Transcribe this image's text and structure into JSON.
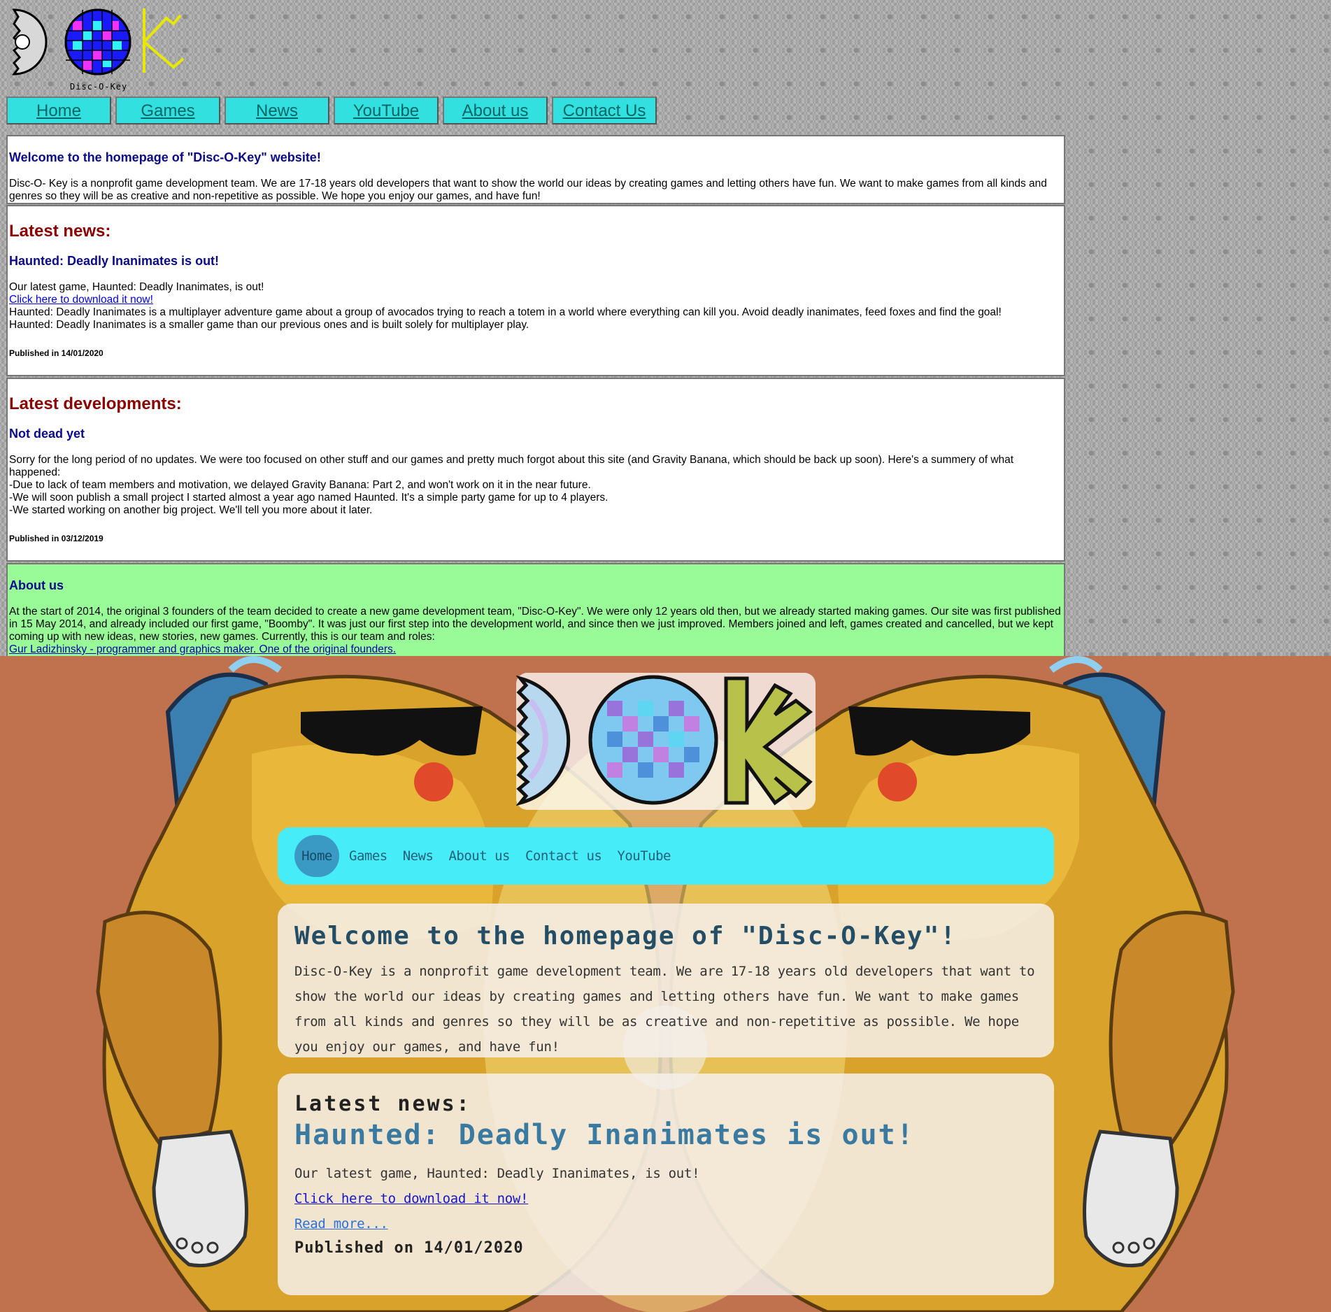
{
  "old_site": {
    "logo_caption": "Disc-O-Key",
    "nav": [
      "Home",
      "Games",
      "News",
      "YouTube",
      "About us",
      "Contact Us"
    ],
    "welcome": {
      "title": "Welcome to the homepage of \"Disc-O-Key\" website!",
      "text": "Disc-O- Key is a nonprofit game development team. We are 17-18 years old developers that want to show the world our ideas by creating games and letting others have fun. We want to make games from all kinds and genres so they will be as creative and non-repetitive as possible. We hope you enjoy our games, and have fun!"
    },
    "news": {
      "heading": "Latest news:",
      "title": "Haunted: Deadly Inanimates is out!",
      "line1": "Our latest game, Haunted: Deadly Inanimates, is out!",
      "link": "Click here to download it now!",
      "line2": "Haunted: Deadly Inanimates is a multiplayer adventure game about a group of avocados trying to reach a totem in a world where everything can kill you. Avoid deadly inanimates, feed foxes and find the goal!",
      "line3": "Haunted: Deadly Inanimates is a smaller game than our previous ones and is built solely for multiplayer play.",
      "published": "Published in 14/01/2020"
    },
    "developments": {
      "heading": "Latest developments:",
      "title": "Not dead yet",
      "line1": "Sorry for the long period of no updates. We were too focused on other stuff and our games and pretty much forgot about this site (and Gravity Banana, which should be back up soon). Here's a summery of what happened:",
      "line2": "-Due to lack of team members and motivation, we delayed Gravity Banana: Part 2, and won't work on it in the near future.",
      "line3": "-We will soon publish a small project I started almost a year ago named Haunted. It's a simple party game for up to 4 players.",
      "line4": "-We started working on another big project. We'll tell you more about it later.",
      "published": "Published in 03/12/2019"
    },
    "about": {
      "title": "About us",
      "text": "At the start of 2014, the original 3 founders of the team decided to create a new game development team, \"Disc-O-Key\". We were only 12 years old then, but we already started making games. Our site was first published in 15 May 2014, and already included our first game, \"Boomby\". It was just our first step into the development world, and since then we just improved. Members joined and left, games created and cancelled, but we kept coming up with new ideas, new stories, new games. Currently, this is our team and roles:",
      "member_link": "Gur Ladizhinsky - programmer and graphics maker. One of the original founders."
    },
    "colors": {
      "nav_bg": "#33e0e0",
      "about_bg": "#98fb98",
      "heading_red": "#8b0000",
      "heading_blue": "#0a0a8a"
    }
  },
  "new_site": {
    "nav": [
      "Home",
      "Games",
      "News",
      "About us",
      "Contact us",
      "YouTube"
    ],
    "welcome": {
      "title": "Welcome to the homepage of \"Disc-O-Key\"!",
      "text": "Disc-O-Key is a nonprofit game development team. We are 17-18 years old developers that want to show the world our ideas by creating games and letting others have fun. We want to make games from all kinds and genres so they will be as creative and non-repetitive as possible. We hope you enjoy our games, and have fun!"
    },
    "news": {
      "heading": "Latest news:",
      "title": "Haunted: Deadly Inanimates is out!",
      "line1": "Our latest game, Haunted: Deadly Inanimates, is out!",
      "link": "Click here to download it now!",
      "read_more": "Read more...",
      "published": "Published on 14/01/2020"
    },
    "colors": {
      "page_bg": "#c0714e",
      "nav_bg": "#46edf8",
      "active_nav": "#3a9ac4",
      "title_blue": "#3a7aa0"
    }
  }
}
